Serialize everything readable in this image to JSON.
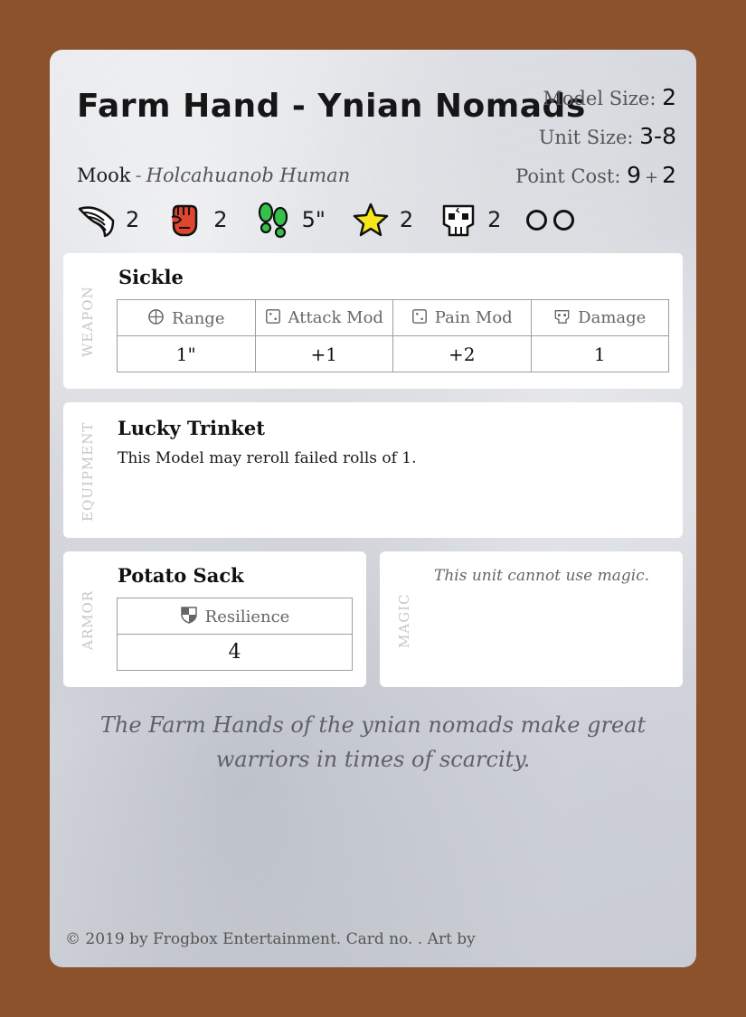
{
  "card": {
    "title": "Farm Hand - Ynian Nomads",
    "model_size_label": "Model Size:",
    "model_size": "2",
    "unit_size_label": "Unit Size:",
    "unit_size": "3-8",
    "point_cost_label": "Point Cost:",
    "point_cost": "9",
    "point_cost_plus": "+",
    "point_cost_extra": "2",
    "rank": "Mook",
    "rank_separator": "-",
    "race": "Holcahuanob Human",
    "stats": [
      {
        "icon": "wing-icon",
        "value": "2"
      },
      {
        "icon": "fist-icon",
        "value": "2"
      },
      {
        "icon": "footprints-icon",
        "value": "5\""
      },
      {
        "icon": "star-icon",
        "value": "2"
      },
      {
        "icon": "skull-icon",
        "value": "2"
      }
    ],
    "empty_slots": 2,
    "colors": {
      "background": "#8b522c",
      "fist": "#e0462f",
      "footprints": "#35c24a",
      "star": "#f7e61a"
    }
  },
  "weapon": {
    "section_label": "WEAPON",
    "name": "Sickle",
    "headers": [
      "Range",
      "Attack Mod",
      "Pain Mod",
      "Damage"
    ],
    "values": [
      "1\"",
      "+1",
      "+2",
      "1"
    ]
  },
  "equipment": {
    "section_label": "EQUIPMENT",
    "name": "Lucky Trinket",
    "text": "This Model may reroll failed rolls of 1."
  },
  "armor": {
    "section_label": "ARMOR",
    "name": "Potato Sack",
    "header": "Resilience",
    "value": "4"
  },
  "magic": {
    "section_label": "MAGIC",
    "text": "This unit cannot use magic."
  },
  "flavor": {
    "line1": "The Farm Hands of the ynian nomads make great",
    "line2": "warriors in times of scarcity."
  },
  "footer": "© 2019 by Frogbox Entertainment. Card no. . Art by"
}
